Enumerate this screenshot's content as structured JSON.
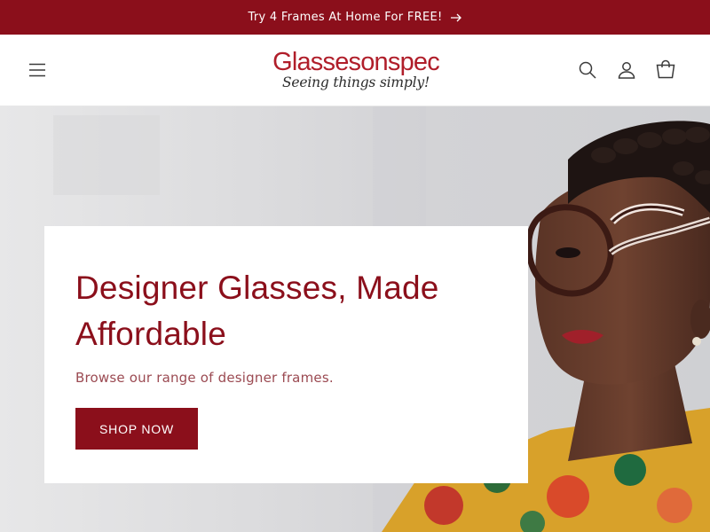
{
  "announcement": {
    "text": "Try 4 Frames At Home For FREE!",
    "icon": "arrow-right-icon"
  },
  "header": {
    "menu_icon": "hamburger-menu-icon",
    "logo": {
      "main": "Glassesonspec",
      "tagline": "Seeing things simply!"
    },
    "icons": [
      "search-icon",
      "account-icon",
      "cart-icon"
    ]
  },
  "hero": {
    "title": "Designer Glasses, Made Affordable",
    "subtitle": "Browse our range of designer frames.",
    "cta_label": "SHOP NOW"
  },
  "colors": {
    "brand": "#8b0f1b",
    "logo_red": "#b01e2a",
    "subtitle": "#9b4a52"
  }
}
